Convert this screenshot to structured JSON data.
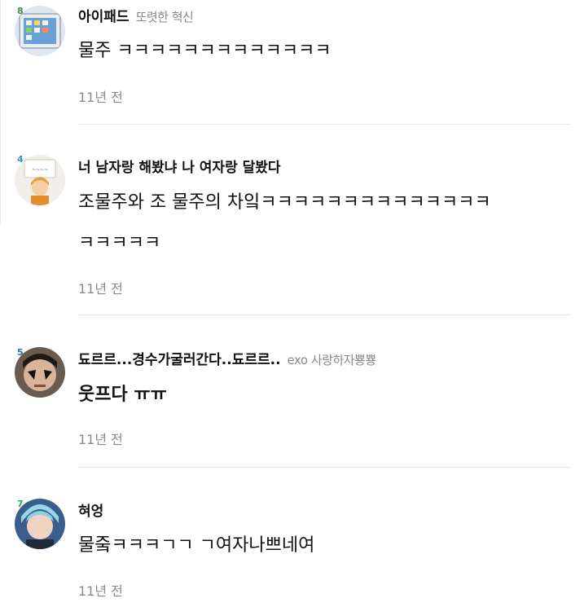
{
  "comments": [
    {
      "level": "8",
      "level_color": "#3a8f5a",
      "nickname": "아이패드",
      "tag": "또렷한 혁신",
      "text_lines": [
        "물주 ㅋㅋㅋㅋㅋㅋㅋㅋㅋㅋㅋㅋㅋ"
      ],
      "time": "11년 전"
    },
    {
      "level": "4",
      "level_color": "#2a9bd0",
      "nickname": "너 남자랑 해봤냐 나 여자랑 달봤다",
      "tag": "",
      "text_lines": [
        "조물주와 조 물주의 차잌ㅋㅋㅋㅋㅋㅋㅋㅋㅋㅋㅋㅋㅋㅋ",
        "ㅋㅋㅋㅋㅋ"
      ],
      "time": "11년 전"
    },
    {
      "level": "5",
      "level_color": "#2b6fc2",
      "nickname": "됴르르...경수가굴러간다..됴르르..",
      "tag": "exo 사랑하자뿅뿅",
      "text_lines": [
        "웃프다 ㅠㅠ"
      ],
      "time": "11년 전"
    },
    {
      "level": "7",
      "level_color": "#3aa76a",
      "nickname": "혀엉",
      "tag": "",
      "text_lines": [
        "물줔ㅋㅋㅋㄱㄱ ㄱ여자나쁘네여"
      ],
      "time": "11년 전"
    }
  ]
}
